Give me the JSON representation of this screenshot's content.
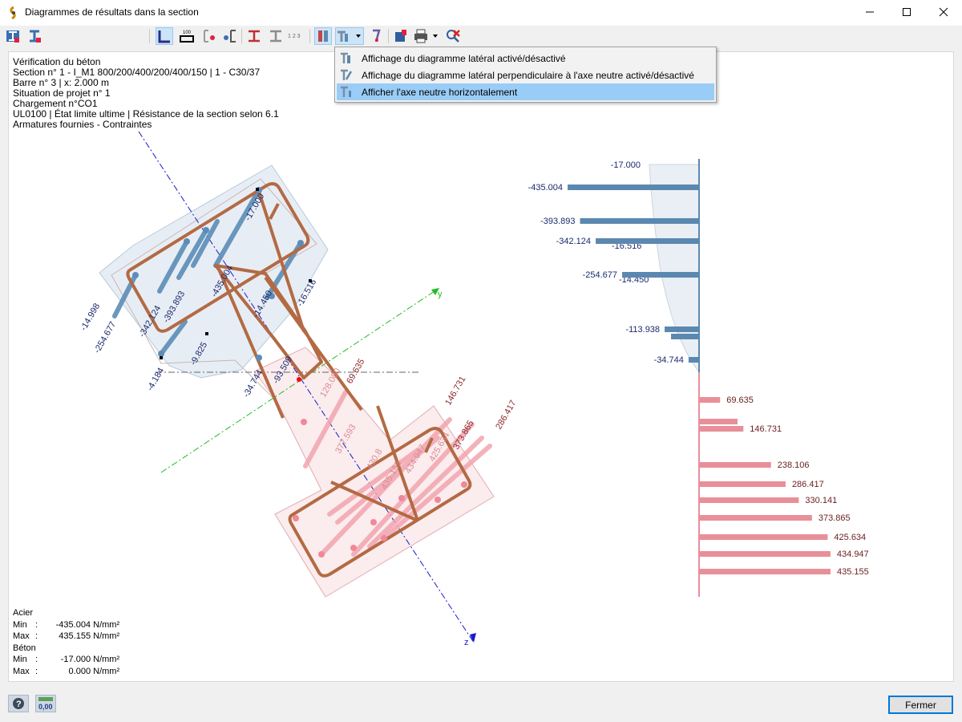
{
  "window": {
    "title": "Diagrammes de résultats dans la section"
  },
  "toolbar": {
    "zoom_value": "100",
    "zoom_unit": "[%]",
    "scale_button_label": "100",
    "print_numbers_label": "1 2 3"
  },
  "dropdown_menu": {
    "items": [
      {
        "label": "Affichage du diagramme latéral activé/désactivé"
      },
      {
        "label": "Affichage du diagramme latéral perpendiculaire à l'axe neutre activé/désactivé"
      },
      {
        "label": "Afficher l'axe neutre horizontalement"
      }
    ],
    "highlighted_index": 2
  },
  "info": {
    "lines": [
      "Vérification du béton",
      "Section n° 1 - I_M1 800/200/400/200/400/150 | 1 - C30/37",
      "Barre n° 3 | x: 2.000 m",
      "Situation de projet n° 1",
      "Chargement n°CO1",
      "UL0100 | État limite ultime | Résistance de la section selon 6.1",
      "Armatures fournies - Contraintes"
    ]
  },
  "stats": {
    "steel_title": "Acier",
    "steel_min_label": "Min",
    "steel_min_value": "-435.004",
    "steel_min_unit": "N/mm²",
    "steel_max_label": "Max",
    "steel_max_value": "435.155",
    "steel_max_unit": "N/mm²",
    "concrete_title": "Béton",
    "concrete_min_label": "Min",
    "concrete_min_value": "-17.000",
    "concrete_min_unit": "N/mm²",
    "concrete_max_label": "Max",
    "concrete_max_value": "0.000",
    "concrete_max_unit": "N/mm²"
  },
  "section_labels": {
    "compression": [
      "-17.000",
      "-435.004",
      "-393.893",
      "-342.124",
      "-254.677",
      "-14.998",
      "-16.516",
      "-14.450",
      "-9.825",
      "-4.184",
      "-34.744",
      "-93.509"
    ],
    "tension": [
      "69.635",
      "128.080",
      "146.731",
      "286.417",
      "373.865",
      "377.593",
      "430.8",
      "435.155",
      "434.947",
      "425.634"
    ],
    "axis_y": "y",
    "axis_z": "z"
  },
  "side_diagram": {
    "concrete_label": "-17.000",
    "concrete_labels": [
      "-16.516",
      "-14.450"
    ],
    "compression_bars": [
      {
        "label": "-435.004",
        "value": -435.004
      },
      {
        "label": "-393.893",
        "value": -393.893
      },
      {
        "label": "-342.124",
        "value": -342.124
      },
      {
        "label": "-254.677",
        "value": -254.677
      },
      {
        "label": "-113.938",
        "value": -113.938
      },
      {
        "label": "-34.744",
        "value": -34.744
      }
    ],
    "tension_bars": [
      {
        "label": "69.635",
        "value": 69.635
      },
      {
        "label": "146.731",
        "value": 146.731
      },
      {
        "label": "238.106",
        "value": 238.106
      },
      {
        "label": "286.417",
        "value": 286.417
      },
      {
        "label": "330.141",
        "value": 330.141
      },
      {
        "label": "373.865",
        "value": 373.865
      },
      {
        "label": "425.634",
        "value": 425.634
      },
      {
        "label": "434.947",
        "value": 434.947
      },
      {
        "label": "435.155",
        "value": 435.155
      }
    ]
  },
  "status": {
    "results_icon_label": "0,00"
  },
  "buttons": {
    "close_label": "Fermer"
  },
  "colors": {
    "compression": "#5b88b0",
    "tension": "#e88f9a",
    "rebar": "#b36a43",
    "concrete_zone": "#dfe7f0",
    "highlight": "#99ccf6",
    "accent": "#0078d7"
  }
}
